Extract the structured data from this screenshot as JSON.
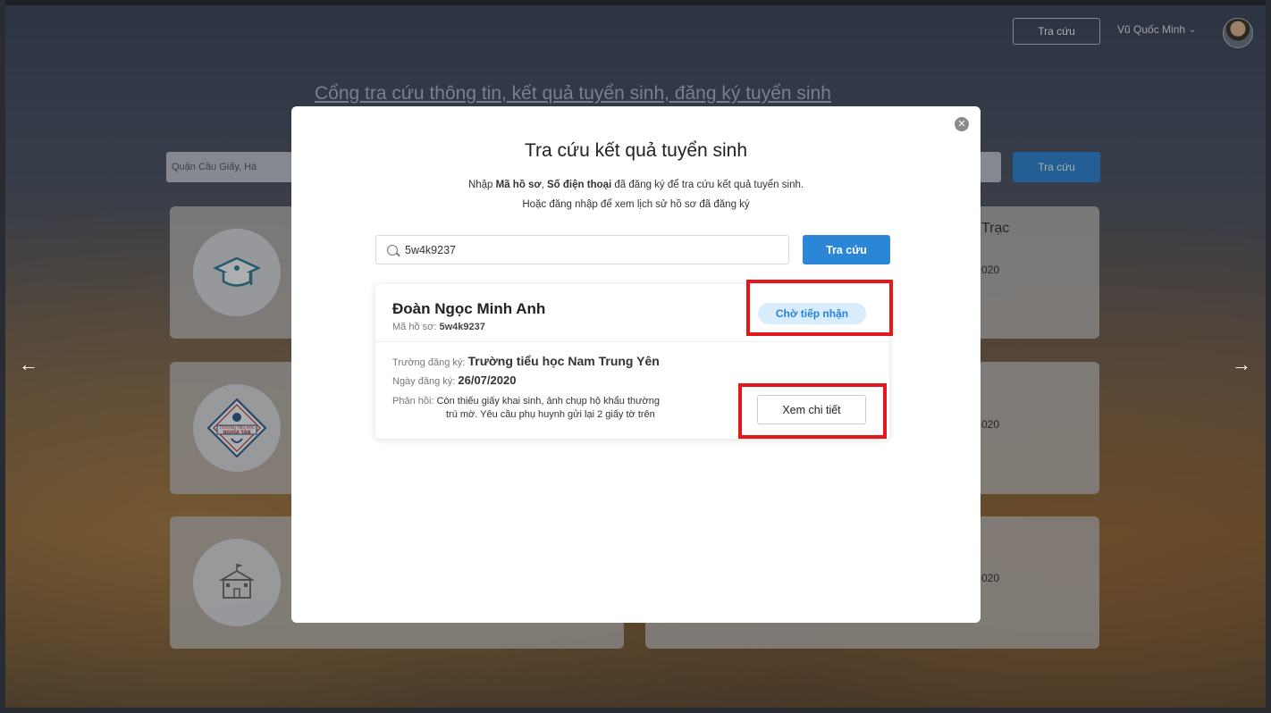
{
  "header": {
    "search_button": "Tra cứu",
    "user_name": "Vũ Quốc Minh"
  },
  "background": {
    "portal_title": "Cổng tra cứu thông tin, kết quả tuyển sinh, đăng ký tuyển sinh",
    "search_location": "Quận Cầu Giấy, Hà",
    "search_button": "Tra cứu",
    "card_title_fragment": "Trạc",
    "card_year_fragments": [
      "020",
      "020",
      "020"
    ],
    "school_badge_text": [
      "TRƯỜNG TIỂU HỌC",
      "NGHĨA TÂN"
    ]
  },
  "modal": {
    "title": "Tra cứu kết quả tuyển sinh",
    "subtitle_prefix": "Nhập ",
    "subtitle_bold1": "Mã hồ sơ",
    "subtitle_sep": ", ",
    "subtitle_bold2": "Số điện thoại",
    "subtitle_suffix": " đã đăng ký để tra cứu kết quả tuyển sinh.",
    "subtitle_line2": "Hoặc đăng nhập để xem lịch sử hồ sơ đã đăng ký",
    "search_value": "5w4k9237",
    "search_button": "Tra cứu"
  },
  "result": {
    "student_name": "Đoàn Ngọc Minh Anh",
    "code_label": "Mã hồ sơ: ",
    "code_value": "5w4k9237",
    "status": "Chờ tiếp nhận",
    "school_label": "Trường đăng ký: ",
    "school_value": "Trường tiểu học Nam Trung Yên",
    "date_label": "Ngày đăng ký: ",
    "date_value": "26/07/2020",
    "feedback_label": "Phản hồi: ",
    "feedback_line1": "Còn thiếu giấy khai sinh, ảnh chụp hộ khẩu thường",
    "feedback_line2": "trú mờ. Yêu cầu phụ huynh gửi lại 2 giấy tờ trên",
    "detail_button": "Xem chi tiết"
  },
  "icons": {
    "close": "close-icon",
    "search": "search-icon",
    "prev": "arrow-left-icon",
    "next": "arrow-right-icon"
  },
  "colors": {
    "primary": "#2b86d6",
    "badge_bg": "#d8ecfb",
    "highlight": "#e5171a"
  }
}
